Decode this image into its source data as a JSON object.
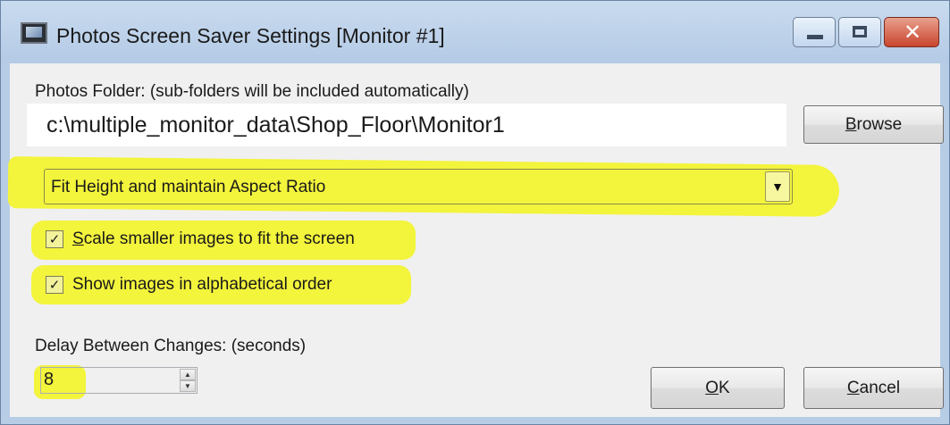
{
  "window": {
    "title": "Photos Screen Saver Settings [Monitor #1]",
    "close_glyph": "✕",
    "icon": "monitor-screen-icon"
  },
  "folder": {
    "label": "Photos Folder: (sub-folders will be included automatically)",
    "value": "c:\\multiple_monitor_data\\Shop_Floor\\Monitor1",
    "browse_label": "Browse",
    "browse_mnemonic": "B",
    "browse_rest": "rowse"
  },
  "scaling": {
    "selected": "Fit Height and maintain Aspect Ratio",
    "arrow_glyph": "▼"
  },
  "options": {
    "scale_smaller": {
      "mnemonic": "S",
      "rest": "cale smaller images to fit the screen",
      "checked": true
    },
    "alphabetical": {
      "label": "Show images in alphabetical order",
      "checked": true
    },
    "check_glyph": "✓"
  },
  "delay": {
    "label": "Delay Between Changes: (seconds)",
    "value": "8",
    "up_glyph": "▲",
    "down_glyph": "▼"
  },
  "buttons": {
    "ok_mnemonic": "O",
    "ok_rest": "K",
    "cancel_mnemonic": "C",
    "cancel_rest": "ancel"
  },
  "colors": {
    "highlight": "#f3f43c",
    "titlebar": "#b7cde6",
    "client_bg": "#f0f0f0"
  }
}
